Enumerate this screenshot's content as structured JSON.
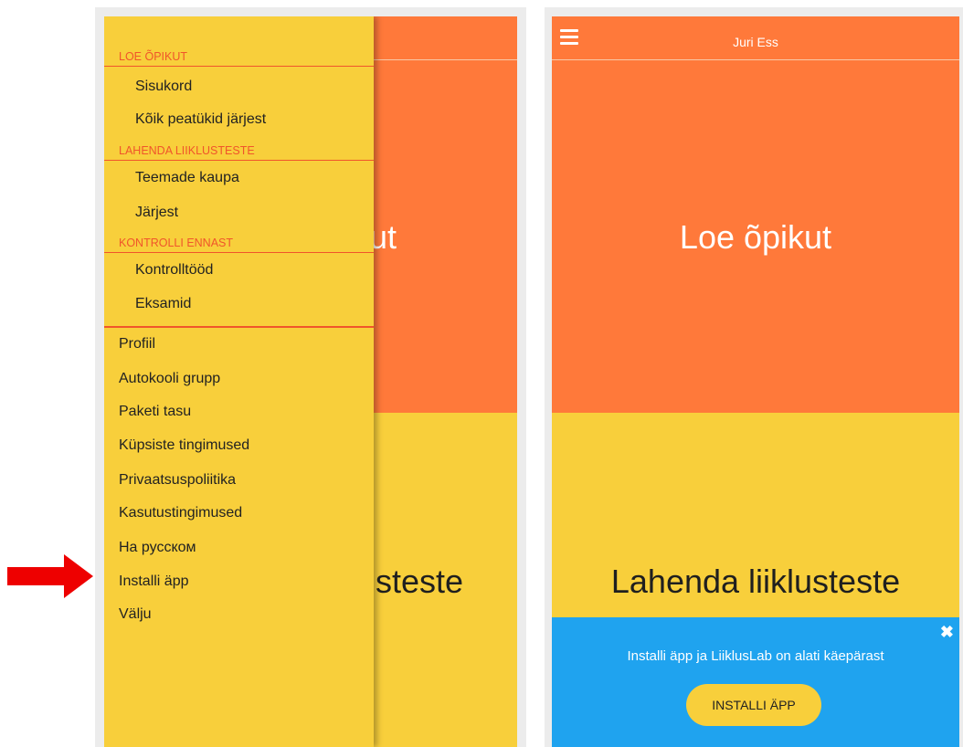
{
  "left_phone": {
    "background": {
      "top_text": "ut",
      "bottom_text": "steste"
    },
    "drawer": {
      "sections": [
        {
          "header": "LOE ÕPIKUT",
          "items": [
            "Sisukord",
            "Kõik peatükid järjest"
          ]
        },
        {
          "header": "LAHENDA LIIKLUSTESTE",
          "items": [
            "Teemade kaupa",
            "Järjest"
          ]
        },
        {
          "header": "KONTROLLI ENNAST",
          "items": [
            "Kontrolltööd",
            "Eksamid"
          ]
        }
      ],
      "main_items": [
        "Profiil",
        "Autokooli grupp",
        "Paketi tasu",
        "Küpsiste tingimused",
        "Privaatsuspoliitika",
        "Kasutustingimused",
        "На русском",
        "Installi äpp",
        "Välju"
      ]
    }
  },
  "right_phone": {
    "user_name": "Juri Ess",
    "title_read": "Loe õpikut",
    "title_tests": "Lahenda liiklusteste",
    "install_banner": {
      "text": "Installi äpp ja LiiklusLab on alati käepärast",
      "button_label": "INSTALLI ÄPP",
      "close_icon": "✖"
    }
  },
  "colors": {
    "orange": "#ff793a",
    "yellow": "#f8cf3b",
    "blue": "#1fa3ef",
    "section_header": "#f0552b",
    "arrow": "#ee0000"
  }
}
